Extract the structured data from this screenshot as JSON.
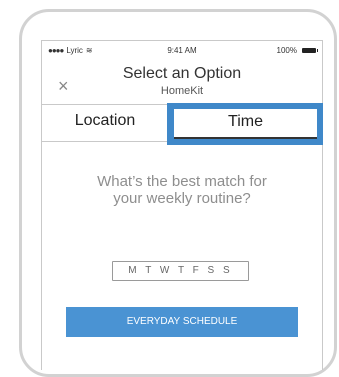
{
  "status_bar": {
    "signal": "●●●● ",
    "carrier": "Lyric",
    "wifi_icon": "wifi-icon",
    "time": "9:41 AM",
    "battery_text": "100%"
  },
  "header": {
    "title": "Select an Option",
    "subtitle": "HomeKit",
    "close_icon": "×"
  },
  "tabs": [
    {
      "label": "Location",
      "selected": false
    },
    {
      "label": "Time",
      "selected": true
    }
  ],
  "question": {
    "line1": "What’s the best match for",
    "line2": "your weekly routine?"
  },
  "days_label": "M T W T F S S",
  "schedule_button": "EVERYDAY SCHEDULE",
  "colors": {
    "accent": "#3f88c9",
    "button": "#4a93d3"
  }
}
